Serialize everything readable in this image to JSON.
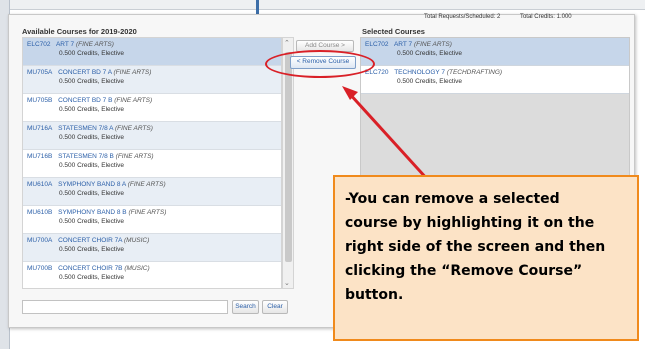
{
  "totals": {
    "requests": "Total Requests/Scheduled: 2",
    "credits": "Total Credits: 1.000"
  },
  "available": {
    "title": "Available Courses for 2019-2020",
    "courses": [
      {
        "code": "ELC702",
        "name": "ART 7",
        "category": "(FINE ARTS)",
        "credits": "0.500 Credits, Elective"
      },
      {
        "code": "MU705A",
        "name": "CONCERT BD 7 A",
        "category": "(FINE ARTS)",
        "credits": "0.500 Credits, Elective"
      },
      {
        "code": "MU705B",
        "name": "CONCERT BD 7 B",
        "category": "(FINE ARTS)",
        "credits": "0.500 Credits, Elective"
      },
      {
        "code": "MU716A",
        "name": "STATESMEN 7/8 A",
        "category": "(FINE ARTS)",
        "credits": "0.500 Credits, Elective"
      },
      {
        "code": "MU716B",
        "name": "STATESMEN 7/8 B",
        "category": "(FINE ARTS)",
        "credits": "0.500 Credits, Elective"
      },
      {
        "code": "MU610A",
        "name": "SYMPHONY BAND 8 A",
        "category": "(FINE ARTS)",
        "credits": "0.500 Credits, Elective"
      },
      {
        "code": "MU610B",
        "name": "SYMPHONY BAND 8 B",
        "category": "(FINE ARTS)",
        "credits": "0.500 Credits, Elective"
      },
      {
        "code": "MU700A",
        "name": "CONCERT CHOIR 7A",
        "category": "(MUSIC)",
        "credits": "0.500 Credits, Elective"
      },
      {
        "code": "MU700B",
        "name": "CONCERT CHOIR 7B",
        "category": "(MUSIC)",
        "credits": "0.500 Credits, Elective"
      }
    ]
  },
  "buttons": {
    "add": "Add Course >",
    "remove": "< Remove Course",
    "search": "Search",
    "clear": "Clear"
  },
  "selected": {
    "title": "Selected Courses",
    "courses": [
      {
        "code": "ELC702",
        "name": "ART 7",
        "category": "(FINE ARTS)",
        "credits": "0.500 Credits, Elective"
      },
      {
        "code": "ELC720",
        "name": "TECHNOLOGY 7",
        "category": "(TECHDRAFTING)",
        "credits": "0.500 Credits, Elective"
      }
    ]
  },
  "callout": {
    "lines": [
      "-You can remove a selected",
      "course by highlighting it on the",
      "right side of the screen and then",
      "clicking the “Remove Course”",
      "button."
    ]
  },
  "colors": {
    "link": "#2b5fa8",
    "annotation": "#d92027",
    "callout_border": "#f08a1c",
    "callout_fill": "#fce3c6"
  }
}
